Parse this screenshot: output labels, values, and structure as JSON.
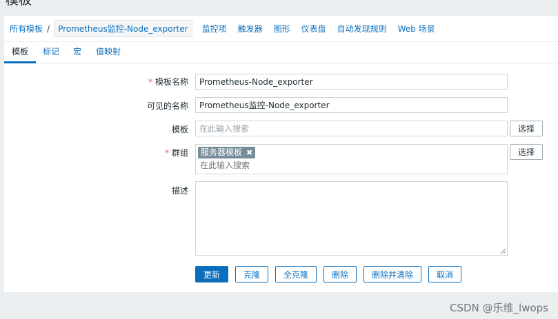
{
  "page": {
    "title": "模板"
  },
  "nav": {
    "root": "所有模板",
    "separator": "/",
    "current": "Prometheus监控-Node_exporter",
    "items": [
      "监控项",
      "触发器",
      "图形",
      "仪表盘",
      "自动发现规则",
      "Web 场景"
    ]
  },
  "tabs": [
    {
      "label": "模板",
      "active": true
    },
    {
      "label": "标记",
      "active": false
    },
    {
      "label": "宏",
      "active": false
    },
    {
      "label": "值映射",
      "active": false
    }
  ],
  "form": {
    "required_mark": "*",
    "template_name": {
      "label": "模板名称",
      "value": "Prometheus-Node_exporter",
      "required": true
    },
    "visible_name": {
      "label": "可见的名称",
      "value": "Prometheus监控-Node_exporter"
    },
    "templates": {
      "label": "模板",
      "placeholder": "在此输入搜索",
      "select_label": "选择"
    },
    "groups": {
      "label": "群组",
      "required": true,
      "chips": [
        "服务器模板"
      ],
      "chip_remove": "✖",
      "placeholder": "在此输入搜索",
      "select_label": "选择"
    },
    "description": {
      "label": "描述",
      "value": ""
    }
  },
  "actions": {
    "update": "更新",
    "clone": "克隆",
    "full_clone": "全克隆",
    "delete": "删除",
    "delete_and_clear": "删除并清除",
    "cancel": "取消"
  },
  "watermark": "CSDN @乐维_lwops",
  "colors": {
    "accent": "#0a6ebd",
    "chip": "#768d99",
    "required": "#e45959",
    "background": "#ebeef0"
  }
}
